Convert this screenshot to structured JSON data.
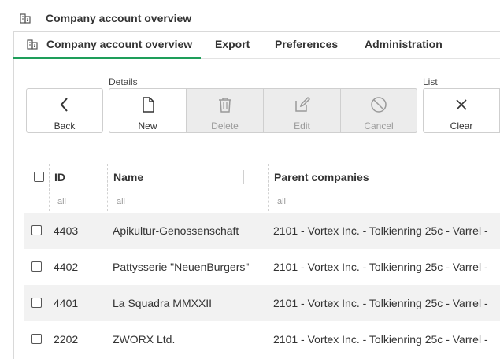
{
  "header": {
    "title": "Company account overview",
    "icon": "building-icon"
  },
  "tabs": [
    {
      "label": "Company account overview",
      "active": true
    },
    {
      "label": "Export"
    },
    {
      "label": "Preferences"
    },
    {
      "label": "Administration"
    }
  ],
  "toolbar": {
    "details_label": "Details",
    "list_label": "List",
    "buttons": {
      "back": {
        "label": "Back",
        "icon": "chevron-left-icon"
      },
      "new": {
        "label": "New",
        "icon": "document-icon"
      },
      "delete": {
        "label": "Delete",
        "icon": "trash-icon",
        "disabled": true
      },
      "edit": {
        "label": "Edit",
        "icon": "pencil-icon",
        "disabled": true
      },
      "cancel": {
        "label": "Cancel",
        "icon": "cancel-icon",
        "disabled": true
      },
      "clear": {
        "label": "Clear",
        "icon": "close-icon"
      }
    }
  },
  "table": {
    "columns": [
      {
        "label": "ID",
        "filter": "all"
      },
      {
        "label": "Name",
        "filter": "all"
      },
      {
        "label": "Parent companies",
        "filter": "all"
      }
    ],
    "rows": [
      {
        "id": "4403",
        "name": "Apikultur-Genossenschaft",
        "parent": "2101 - Vortex Inc. - Tolkienring 25c - Varrel -"
      },
      {
        "id": "4402",
        "name": "Pattysserie \"NeuenBurgers\"",
        "parent": "2101 - Vortex Inc. - Tolkienring 25c - Varrel -"
      },
      {
        "id": "4401",
        "name": "La Squadra MMXXII",
        "parent": "2101 - Vortex Inc. - Tolkienring 25c - Varrel -"
      },
      {
        "id": "2202",
        "name": "ZWORX Ltd.",
        "parent": "2101 - Vortex Inc. - Tolkienring 25c - Varrel -"
      }
    ]
  },
  "colors": {
    "accent": "#1e9e5a",
    "disabled_bg": "#ececec",
    "row_alt": "#f2f2f2"
  }
}
